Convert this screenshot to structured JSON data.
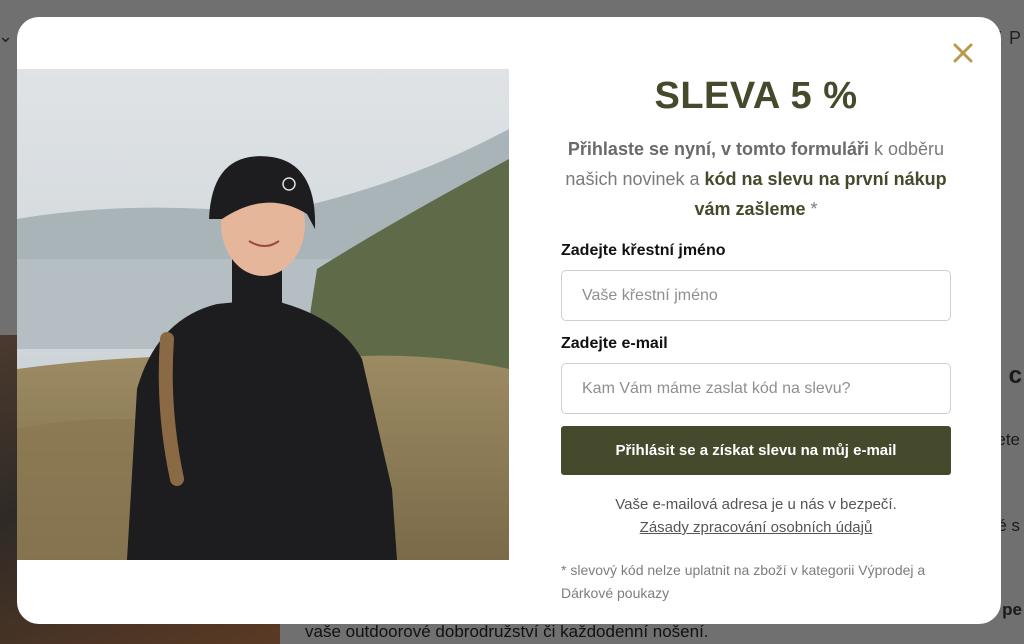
{
  "background": {
    "top_right_text": "É P",
    "right_frag_1": "c",
    "right_frag_2": "ete",
    "right_frag_3": "dé s",
    "right_frag_4": "e pe",
    "bottom_text": "vaše outdoorové dobrodružství či každodenní nošení."
  },
  "modal": {
    "close_icon": "close-icon",
    "title": "SLEVA 5 %",
    "subtitle": {
      "part1": "Přihlaste se nyní, v tomto formuláři",
      "part2": " k odběru našich novinek a ",
      "part3": "kód na slevu na první nákup vám zašleme",
      "part4": " *"
    },
    "first_name": {
      "label": "Zadejte křestní jméno",
      "placeholder": "Vaše křestní jméno",
      "value": ""
    },
    "email": {
      "label": "Zadejte e-mail",
      "placeholder": "Kam Vám máme zaslat kód na slevu?",
      "value": ""
    },
    "submit_label": "Přihlásit se a získat slevu na můj e-mail",
    "privacy_text": "Vaše e-mailová adresa je u nás v bezpečí.",
    "privacy_link": "Zásady zpracování osobních údajů",
    "footnote": "* slevový kód nelze uplatnit na zboží v kategorii Výprodej a Dárkové poukazy"
  },
  "colors": {
    "accent": "#454a2c",
    "close": "#b89a4a",
    "overlay": "#707070"
  }
}
